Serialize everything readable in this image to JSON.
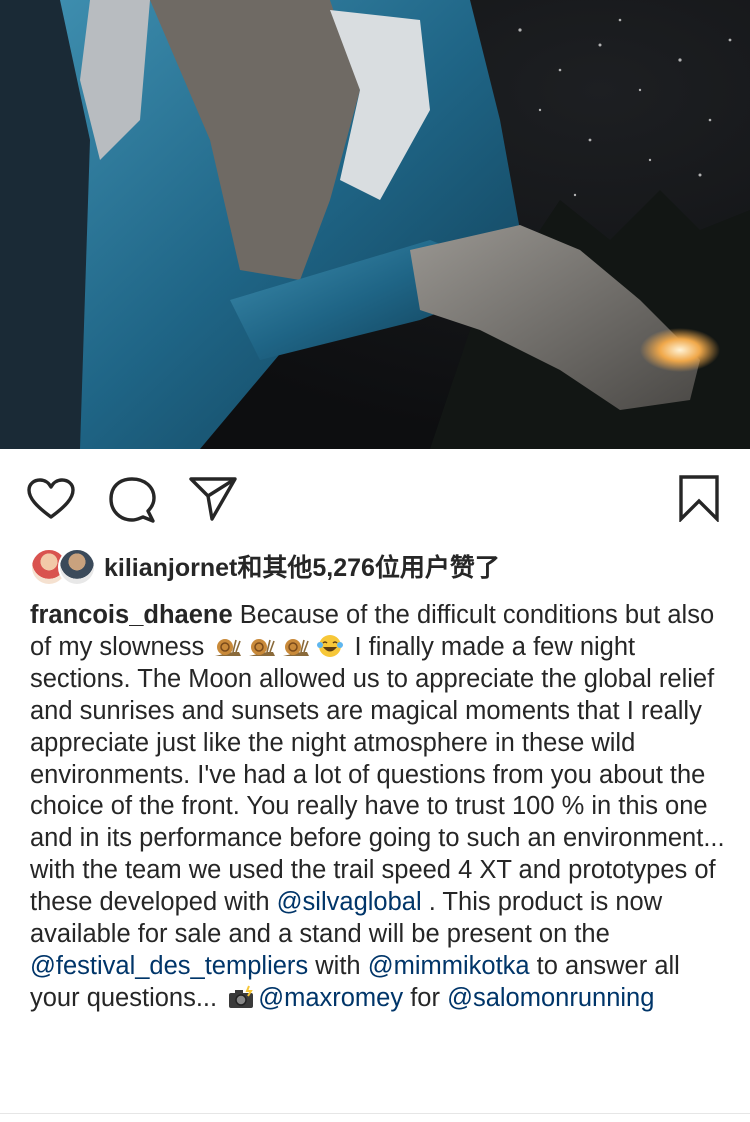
{
  "post": {
    "image": {
      "description_icon": "photo"
    },
    "actions": {
      "like_icon": "heart-icon",
      "comment_icon": "comment-icon",
      "share_icon": "send-icon",
      "save_icon": "bookmark-icon"
    },
    "likes": {
      "text": "kilianjornet和其他5,276位用户赞了"
    },
    "caption": {
      "username": "francois_dhaene",
      "part1": " Because of the difficult conditions but also of my slowness ",
      "emojis1": [
        "snail-emoji",
        "snail-emoji",
        "snail-emoji",
        "laughing-tears-emoji"
      ],
      "part2": " I finally made a few night sections. The Moon allowed us to appreciate the global relief and sunrises and sunsets are magical moments that I really appreciate just like the night atmosphere in these wild environments. I've had a lot of questions from you about the choice of the front. You really have to trust 100 % in this one and in its performance before going to such an environment... with the team we used the trail speed 4 XT and prototypes of these developed with ",
      "mention1": "@silvaglobal",
      "part3": " . This product is now available for sale and a stand will be present on the ",
      "mention2": "@festival_des_templiers",
      "part4": " with ",
      "mention3": "@mimmikotka",
      "part5": " to answer all your questions... ",
      "camera_emoji": "camera-flash-emoji",
      "mention4": "@maxromey",
      "part6": " for ",
      "mention5": "@salomonrunning"
    }
  }
}
